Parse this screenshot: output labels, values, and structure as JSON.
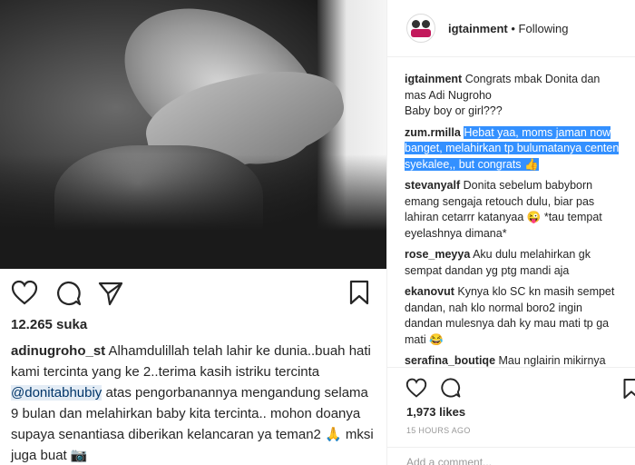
{
  "post": {
    "likes": "12.265 suka",
    "caption_user": "adinugroho_st",
    "caption_part1": "Alhamdulillah telah lahir ke dunia..buah hati kami tercinta yang ke 2..terima kasih istriku tercinta ",
    "caption_mention": "@donitabhubiy",
    "caption_part2": " atas pengorbanannya mengandung selama 9 bulan dan melahirkan baby kita tercinta.. mohon doanya supaya senantiasa diberikan kelancaran ya teman2 🙏 mksi juga buat 📷"
  },
  "panel": {
    "username": "igtainment",
    "separator": "•",
    "follow_status": "Following",
    "comments": [
      {
        "user": "igtainment",
        "text": "Congrats mbak Donita dan mas Adi Nugroho\nBaby boy or girl???"
      },
      {
        "user": "zum.rmilla",
        "text": "Hebat yaa, moms jaman now banget, melahirkan tp bulumatanya centen syekalee,, but congrats 👍"
      },
      {
        "user": "stevanyalf",
        "text": "Donita sebelum babyborn emang sengaja retouch dulu, biar pas lahiran cetarrr katanyaa 😜 *tau tempat eyelashnya dimana*"
      },
      {
        "user": "rose_meyya",
        "text": "Aku dulu melahirkan gk sempat dandan yg ptg mandi aja"
      },
      {
        "user": "ekanovut",
        "text": "Kynya klo SC kn masih sempet dandan, nah klo normal boro2 ingin dandan mulesnya dah ky mau mati tp ga mati 😂"
      },
      {
        "user": "serafina_boutiqe",
        "text": "Mau nglairin mikirnya antara hidup dan mati aja sih kl aq. Ga mikir ke dandan plus foto2 hahaha.. Yah"
      }
    ],
    "likes": "1,973 likes",
    "time": "15 HOURS AGO",
    "add_comment_placeholder": "Add a comment..."
  },
  "icons": [
    "heart-icon",
    "comment-icon",
    "share-icon",
    "bookmark-icon"
  ]
}
